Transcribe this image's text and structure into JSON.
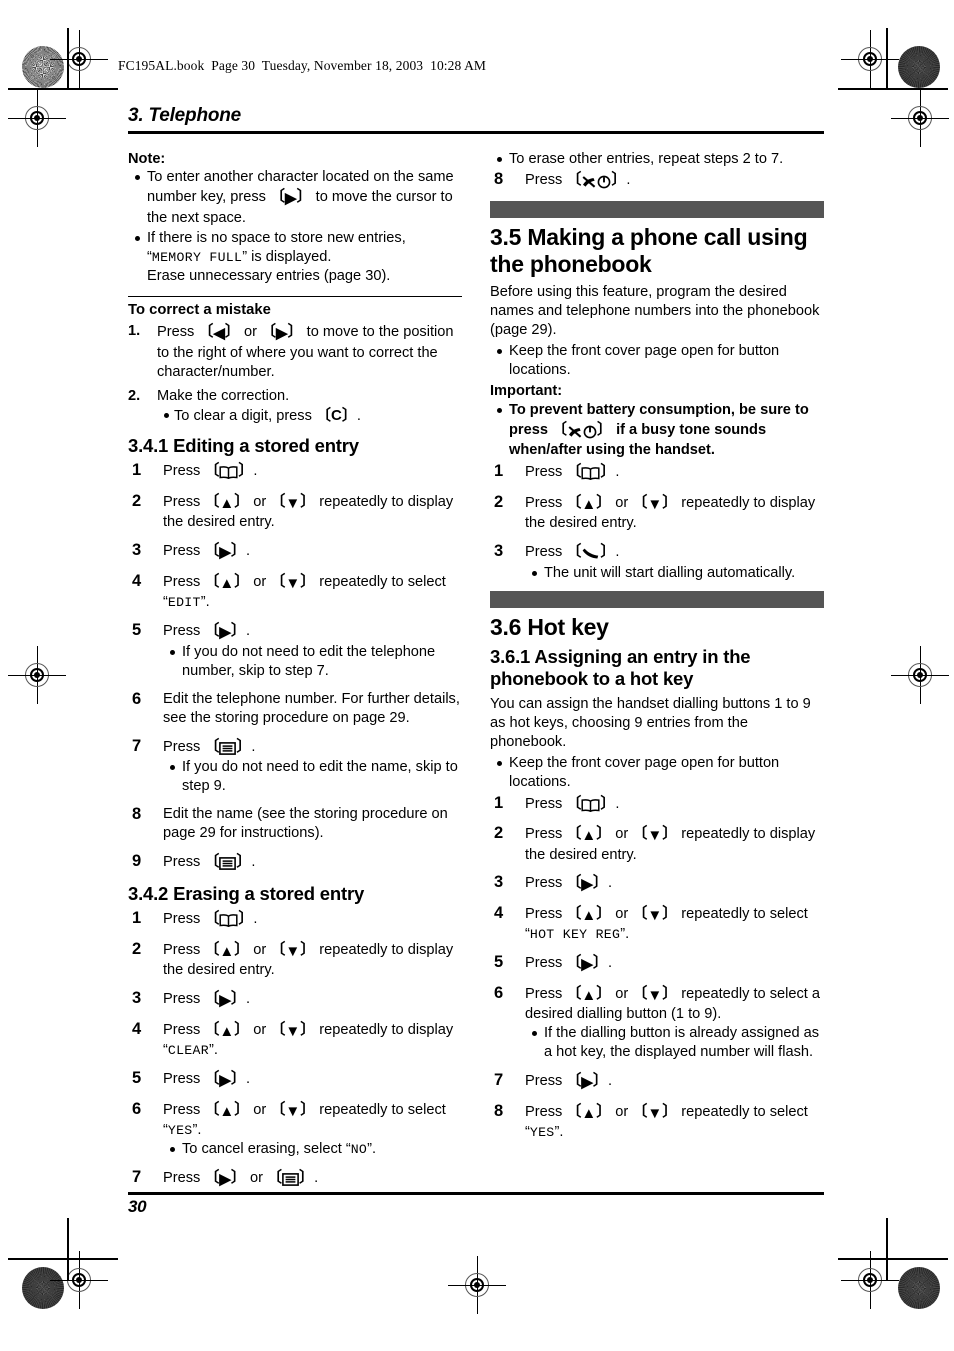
{
  "file_header": "FC195AL.book  Page 30  Tuesday, November 18, 2003  10:28 AM",
  "chapter_title": "3. Telephone",
  "page_number": "30",
  "icons": {
    "phonebook": "phonebook-book-icon",
    "menu_set": "menu-set-icon",
    "up": "up-arrow-icon",
    "down": "down-arrow-icon",
    "left": "left-arrow-icon",
    "right": "right-arrow-icon",
    "off_power": "phone-off-power-icon",
    "talk": "talk-handset-icon"
  },
  "left_column": {
    "note": {
      "heading": "Note:",
      "bullets": [
        {
          "pre": "To enter another character located on the same number key, press ",
          "key": "right",
          "post": " to move the cursor to the next space."
        },
        {
          "pre": "If there is no space to store new entries, “",
          "mono": "MEMORY FULL",
          "post": "” is displayed.\nErase unnecessary entries (page 30)."
        }
      ]
    },
    "correct_mistake": {
      "heading": "To correct a mistake",
      "items": [
        {
          "pre": "Press ",
          "key1": "left",
          "mid": " or ",
          "key2": "right",
          "post": " to move to the position to the right of where you want to correct the character/number."
        },
        {
          "text": "Make the correction.",
          "sub_bullets": [
            {
              "pre": "To clear a digit, press ",
              "key_text": "C",
              "post": "."
            }
          ]
        }
      ]
    },
    "section_341": {
      "title": "3.4.1 Editing a stored entry",
      "steps": [
        {
          "pre": "Press ",
          "key": "phonebook",
          "post": "."
        },
        {
          "pre": "Press ",
          "key1": "up",
          "mid": " or ",
          "key2": "down",
          "post": " repeatedly to display the desired entry."
        },
        {
          "pre": "Press ",
          "key": "right",
          "post": "."
        },
        {
          "pre": "Press ",
          "key1": "up",
          "mid": " or ",
          "key2": "down",
          "post": " repeatedly to select “",
          "mono": "EDIT",
          "tail": "”."
        },
        {
          "pre": "Press ",
          "key": "right",
          "post": ".",
          "sub_bullets": [
            {
              "text": "If you do not need to edit the telephone number, skip to step 7."
            }
          ]
        },
        {
          "text": "Edit the telephone number. For further details, see the storing procedure on page 29."
        },
        {
          "pre": "Press ",
          "key": "menu_set",
          "post": ".",
          "sub_bullets": [
            {
              "text": "If you do not need to edit the name, skip to step 9."
            }
          ]
        },
        {
          "text": "Edit the name (see the storing procedure on page 29 for instructions)."
        },
        {
          "pre": "Press ",
          "key": "menu_set",
          "post": "."
        }
      ]
    },
    "section_342": {
      "title": "3.4.2 Erasing a stored entry",
      "steps": [
        {
          "pre": "Press ",
          "key": "phonebook",
          "post": "."
        },
        {
          "pre": "Press ",
          "key1": "up",
          "mid": " or ",
          "key2": "down",
          "post": " repeatedly to display the desired entry."
        },
        {
          "pre": "Press ",
          "key": "right",
          "post": "."
        },
        {
          "pre": "Press ",
          "key1": "up",
          "mid": " or ",
          "key2": "down",
          "post": " repeatedly to display “",
          "mono": "CLEAR",
          "tail": "”."
        },
        {
          "pre": "Press ",
          "key": "right",
          "post": "."
        },
        {
          "pre": "Press ",
          "key1": "up",
          "mid": " or ",
          "key2": "down",
          "post": " repeatedly to select “",
          "mono": "YES",
          "tail": "”.",
          "sub_bullets": [
            {
              "pre": "To cancel erasing, select “",
              "mono": "NO",
              "post": "”."
            }
          ]
        },
        {
          "pre": "Press ",
          "key1": "right",
          "mid": " or ",
          "key2": "menu_set",
          "post": "."
        }
      ]
    }
  },
  "right_column": {
    "top_bullets": [
      {
        "text": "To erase other entries, repeat steps 2 to 7."
      }
    ],
    "step8": {
      "number": "8",
      "pre": "Press ",
      "key": "off_power",
      "post": "."
    },
    "section_35": {
      "title": "3.5 Making a phone call using the phonebook",
      "intro": "Before using this feature, program the desired names and telephone numbers into the phonebook (page 29).",
      "intro_bullets": [
        {
          "text": "Keep the front cover page open for button locations."
        }
      ],
      "important_heading": "Important:",
      "important_bullets": [
        {
          "pre": "To prevent battery consumption, be sure to press ",
          "key": "off_power",
          "post": " if a busy tone sounds when/after using the handset."
        }
      ],
      "steps": [
        {
          "pre": "Press ",
          "key": "phonebook",
          "post": "."
        },
        {
          "pre": "Press ",
          "key1": "up",
          "mid": " or ",
          "key2": "down",
          "post": " repeatedly to display the desired entry."
        },
        {
          "pre": "Press ",
          "key": "talk",
          "post": ".",
          "sub_bullets": [
            {
              "text": "The unit will start dialling automatically."
            }
          ]
        }
      ]
    },
    "section_36": {
      "title": "3.6 Hot key",
      "sub_title": "3.6.1 Assigning an entry in the phonebook to a hot key",
      "intro": "You can assign the handset dialling buttons 1 to 9 as hot keys, choosing 9 entries from the phonebook.",
      "intro_bullets": [
        {
          "text": "Keep the front cover page open for button locations."
        }
      ],
      "steps": [
        {
          "pre": "Press ",
          "key": "phonebook",
          "post": "."
        },
        {
          "pre": "Press ",
          "key1": "up",
          "mid": " or ",
          "key2": "down",
          "post": " repeatedly to display the desired entry."
        },
        {
          "pre": "Press ",
          "key": "right",
          "post": "."
        },
        {
          "pre": "Press ",
          "key1": "up",
          "mid": " or ",
          "key2": "down",
          "post": " repeatedly to select “",
          "mono": "HOT KEY REG",
          "tail": "”."
        },
        {
          "pre": "Press ",
          "key": "right",
          "post": "."
        },
        {
          "pre": "Press ",
          "key1": "up",
          "mid": " or ",
          "key2": "down",
          "post": " repeatedly to select a desired dialling button (1 to 9).",
          "sub_bullets": [
            {
              "text": "If the dialling button is already assigned as a hot key, the displayed number will flash."
            }
          ]
        },
        {
          "pre": "Press ",
          "key": "right",
          "post": "."
        },
        {
          "pre": "Press ",
          "key1": "up",
          "mid": " or ",
          "key2": "down",
          "post": " repeatedly to select “",
          "mono": "YES",
          "tail": "”."
        }
      ]
    }
  },
  "colors": {
    "section_bar": "#555555",
    "text": "#000000",
    "mono_text": "#222222"
  }
}
